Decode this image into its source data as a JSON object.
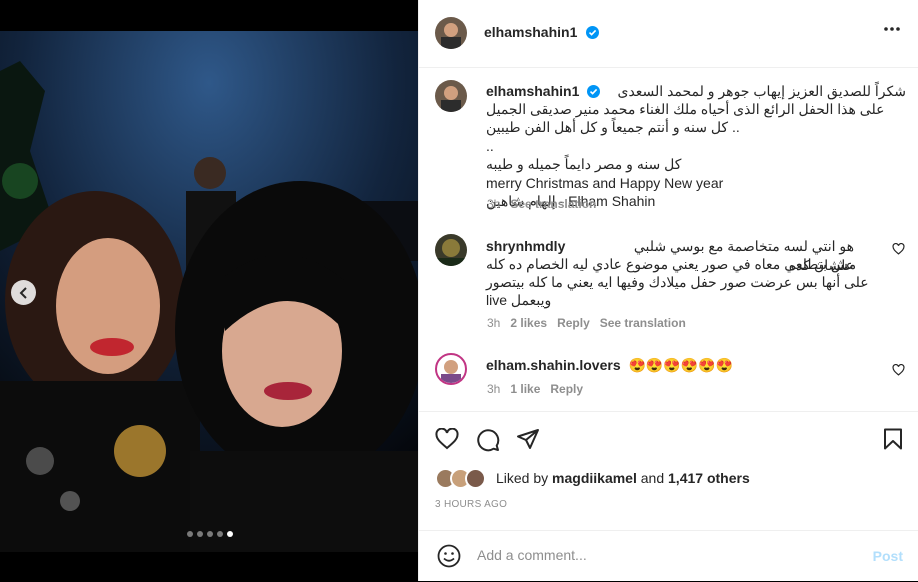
{
  "post": {
    "username": "elhamshahin1",
    "caption_lines": [
      "شكراً للصديق العزيز إيهاب جوهر و لمحمد السعدى",
      "على هذا الحفل الرائع الذى أحياه ملك الغناء محمد منير صديقى الجميل",
      ".. كل سنه و أنتم جميعاً و كل أهل الفن طيبين",
      "..",
      "كل سنه و مصر دايماً جميله و طيبه",
      "merry Christmas and Happy New year",
      "إلهام شاهين - Elham Shahin"
    ],
    "caption_time": "3h",
    "caption_see_translation": "See translation"
  },
  "comments": [
    {
      "username": "shrynhmdly",
      "text_lines": [
        "هو انتي لسه متخاصمة مع بوسي شلبي علشان كده",
        "مش بتطلعي معاه في صور يعني موضوع عادي ليه الخصام ده كله",
        "على أنها بس عرضت صور حفل ميلادك وفيها ايه يعني ما كله بيتصور",
        "live ويبعمل"
      ],
      "time": "3h",
      "likes": "2 likes",
      "reply": "Reply",
      "see_translation": "See translation"
    },
    {
      "username": "elham.shahin.lovers",
      "text": "😍😍😍😍😍😍",
      "time": "3h",
      "likes": "1 like",
      "reply": "Reply"
    }
  ],
  "likes": {
    "prefix": "Liked by",
    "user": "magdiikamel",
    "and": "and",
    "others": "1,417 others"
  },
  "timestamp": "3 HOURS AGO",
  "add_comment": {
    "placeholder": "Add a comment...",
    "post_label": "Post"
  },
  "carousel": {
    "total_slides": 5,
    "active_slide": 5
  },
  "colors": {
    "verified": "#0095f6",
    "post_disabled": "#b2dffc",
    "muted": "#8e8e8e"
  },
  "icons": [
    "more-icon",
    "heart-icon",
    "comment-icon",
    "share-icon",
    "bookmark-icon",
    "emoji-icon",
    "chevron-left-icon",
    "verified-icon"
  ]
}
